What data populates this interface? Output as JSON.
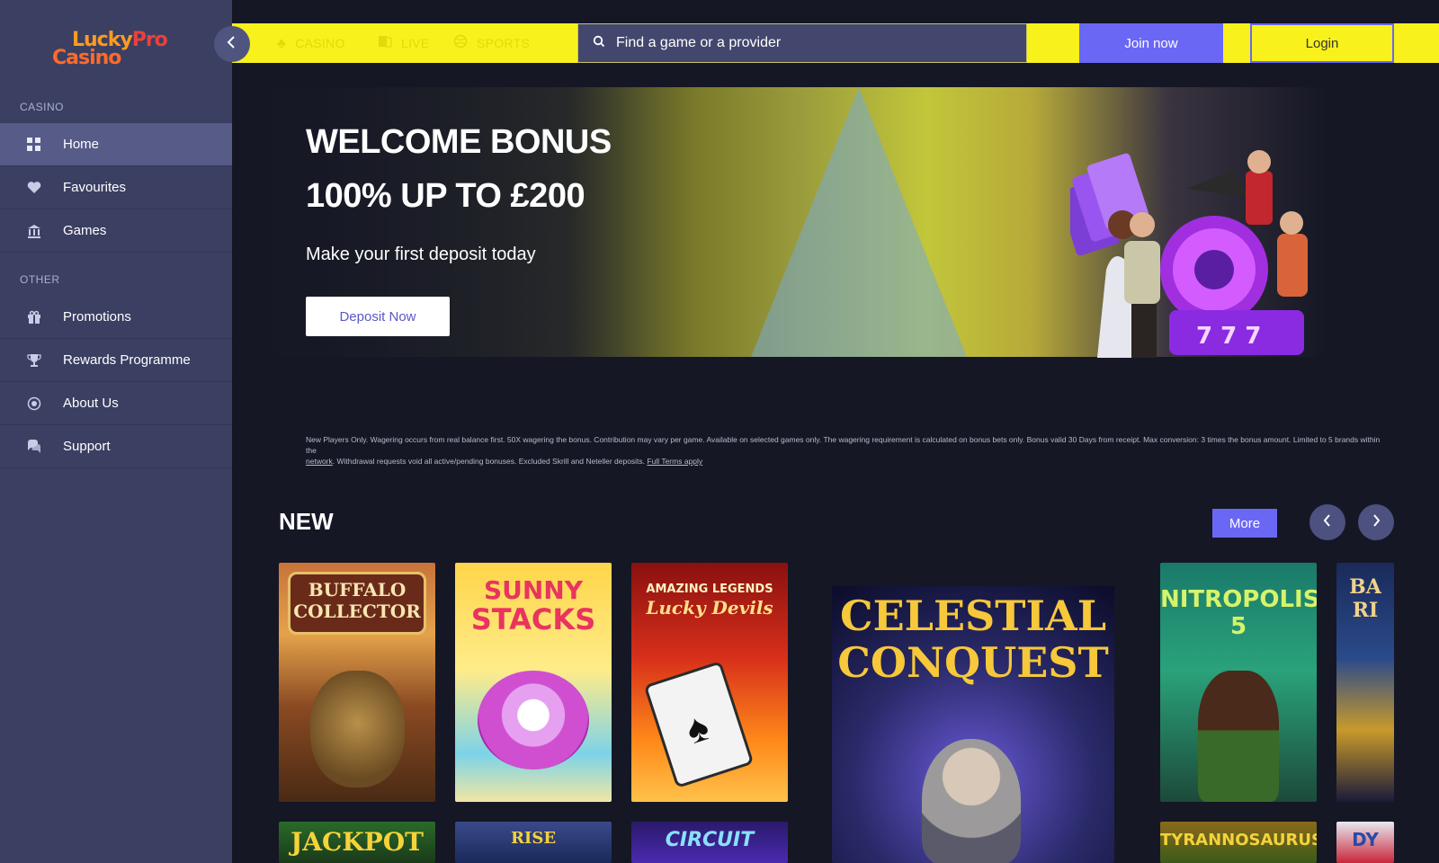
{
  "brand": {
    "logo_line1": "Lucky",
    "logo_line1_accent": "Pro",
    "logo_line2": "Casino"
  },
  "sidebar": {
    "casino_label": "CASINO",
    "other_label": "OTHER",
    "items": [
      {
        "label": "Home",
        "icon": "grid-icon",
        "active": true
      },
      {
        "label": "Favourites",
        "icon": "heart-icon"
      },
      {
        "label": "Games",
        "icon": "building-icon"
      },
      {
        "label": "Promotions",
        "icon": "gift-icon"
      },
      {
        "label": "Rewards Programme",
        "icon": "trophy-icon"
      },
      {
        "label": "About Us",
        "icon": "info-circle-icon"
      },
      {
        "label": "Support",
        "icon": "chat-icon"
      }
    ]
  },
  "header": {
    "tabs": [
      {
        "label": "CASINO",
        "icon": "club-icon"
      },
      {
        "label": "LIVE",
        "icon": "live-cards-icon"
      },
      {
        "label": "SPORTS",
        "icon": "ball-icon"
      }
    ],
    "search_placeholder": "Find a game or a provider",
    "join_label": "Join now",
    "login_label": "Login"
  },
  "banner": {
    "title_line1": "WELCOME BONUS",
    "title_line2": "100% UP TO £200",
    "subtitle": "Make your first deposit today",
    "cta": "Deposit Now"
  },
  "terms": {
    "text": "New Players Only. Wagering occurs from real balance first. 50X wagering the bonus. Contribution may vary per game. Available on selected games only. The wagering requirement is calculated on bonus bets only. Bonus valid 30 Days from receipt. Max conversion: 3 times the bonus amount. Limited to 5 brands within the",
    "link1": "network",
    "text2": ". Withdrawal requests void all active/pending bonuses. Excluded Skrill and Neteller deposits.",
    "link2": "Full Terms apply"
  },
  "new_section": {
    "title": "NEW",
    "more_label": "More",
    "games": [
      {
        "line1": "BUFFALO",
        "line2": "COLLECTOR"
      },
      {
        "line1": "SUNNY",
        "line2": "STACKS"
      },
      {
        "line1": "AMAZING LEGENDS",
        "line2": "Lucky Devils"
      },
      {
        "line1": "CELESTIAL",
        "line2": "CONQUEST"
      },
      {
        "line1": "NITROPOLIS 5",
        "line2": ""
      },
      {
        "line1": "BA",
        "line2": "RI"
      },
      {
        "line1": "JACKPOT",
        "line2": ""
      },
      {
        "line1": "RISE",
        "line2": ""
      },
      {
        "line1": "CIRCUIT",
        "line2": ""
      },
      {
        "line1": "TYRANNOSAURUS",
        "line2": ""
      },
      {
        "line1": "DY",
        "line2": ""
      }
    ]
  }
}
